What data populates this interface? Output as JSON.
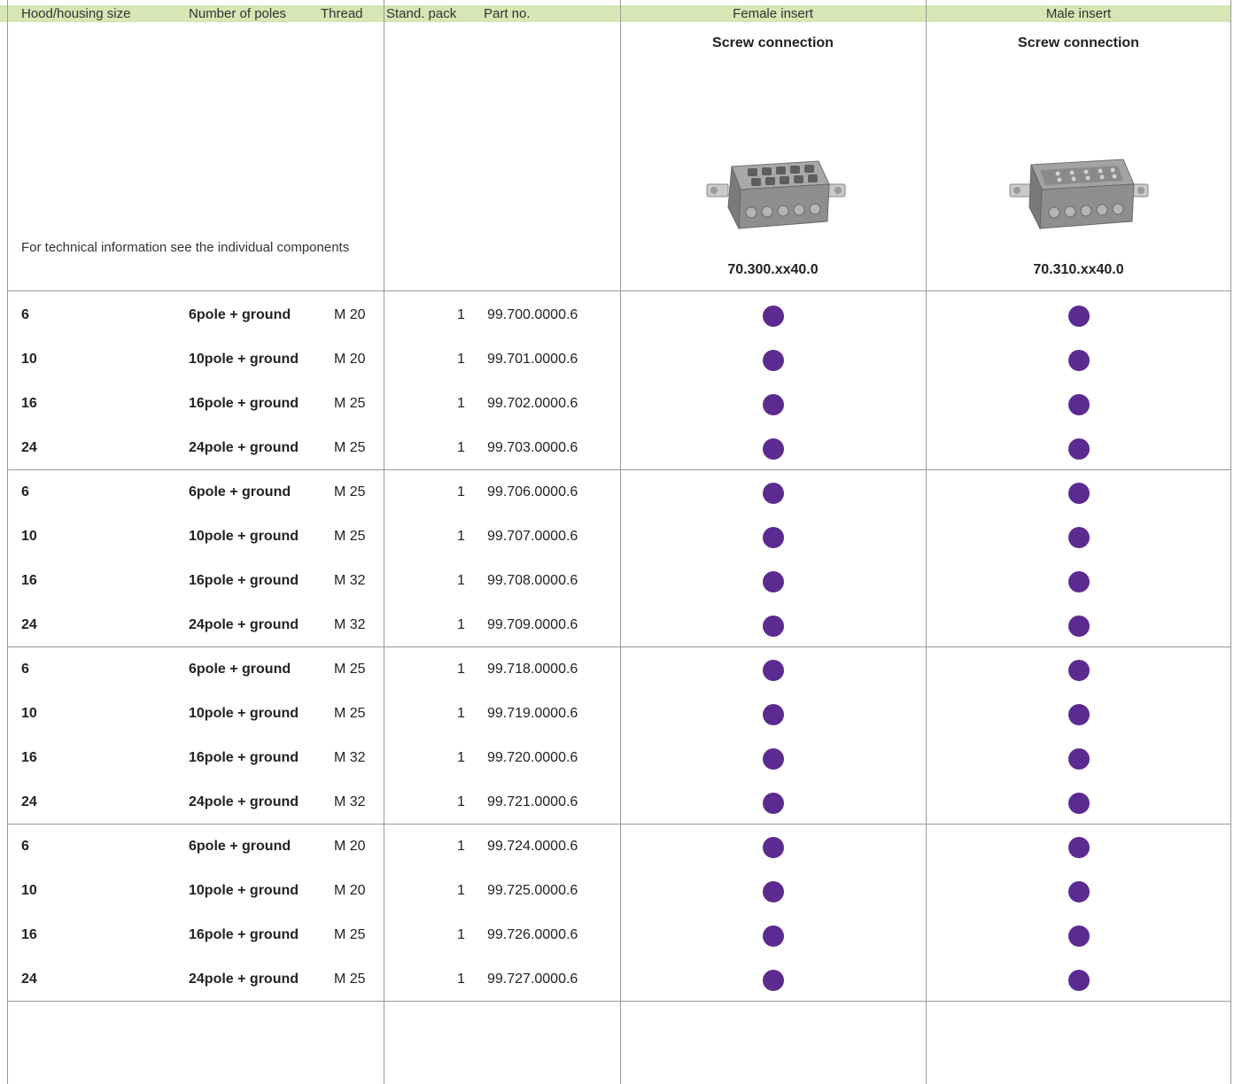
{
  "header": {
    "hood_size": "Hood/housing size",
    "num_poles": "Number of poles",
    "thread": "Thread",
    "stand_pack": "Stand. pack",
    "part_no": "Part no.",
    "female_insert": "Female insert",
    "male_insert": "Male insert"
  },
  "female": {
    "connection": "Screw connection",
    "part": "70.300.xx40.0"
  },
  "male": {
    "connection": "Screw connection",
    "part": "70.310.xx40.0"
  },
  "note": "For technical information see the individual components",
  "accent_color": "#5c2b92",
  "header_bg": "#d6e6b4",
  "rows": [
    {
      "size": "6",
      "poles": "6pole + ground",
      "thread": "M 20",
      "pack": "1",
      "part": "99.700.0000.6"
    },
    {
      "size": "10",
      "poles": "10pole + ground",
      "thread": "M 20",
      "pack": "1",
      "part": "99.701.0000.6"
    },
    {
      "size": "16",
      "poles": "16pole + ground",
      "thread": "M 25",
      "pack": "1",
      "part": "99.702.0000.6"
    },
    {
      "size": "24",
      "poles": "24pole + ground",
      "thread": "M 25",
      "pack": "1",
      "part": "99.703.0000.6"
    },
    {
      "size": "6",
      "poles": "6pole + ground",
      "thread": "M 25",
      "pack": "1",
      "part": "99.706.0000.6"
    },
    {
      "size": "10",
      "poles": "10pole + ground",
      "thread": "M 25",
      "pack": "1",
      "part": "99.707.0000.6"
    },
    {
      "size": "16",
      "poles": "16pole + ground",
      "thread": "M 32",
      "pack": "1",
      "part": "99.708.0000.6"
    },
    {
      "size": "24",
      "poles": "24pole + ground",
      "thread": "M 32",
      "pack": "1",
      "part": "99.709.0000.6"
    },
    {
      "size": "6",
      "poles": "6pole + ground",
      "thread": "M 25",
      "pack": "1",
      "part": "99.718.0000.6"
    },
    {
      "size": "10",
      "poles": "10pole + ground",
      "thread": "M 25",
      "pack": "1",
      "part": "99.719.0000.6"
    },
    {
      "size": "16",
      "poles": "16pole + ground",
      "thread": "M 32",
      "pack": "1",
      "part": "99.720.0000.6"
    },
    {
      "size": "24",
      "poles": "24pole + ground",
      "thread": "M 32",
      "pack": "1",
      "part": "99.721.0000.6"
    },
    {
      "size": "6",
      "poles": "6pole + ground",
      "thread": "M 20",
      "pack": "1",
      "part": "99.724.0000.6"
    },
    {
      "size": "10",
      "poles": "10pole + ground",
      "thread": "M 20",
      "pack": "1",
      "part": "99.725.0000.6"
    },
    {
      "size": "16",
      "poles": "16pole + ground",
      "thread": "M 25",
      "pack": "1",
      "part": "99.726.0000.6"
    },
    {
      "size": "24",
      "poles": "24pole + ground",
      "thread": "M 25",
      "pack": "1",
      "part": "99.727.0000.6"
    }
  ]
}
